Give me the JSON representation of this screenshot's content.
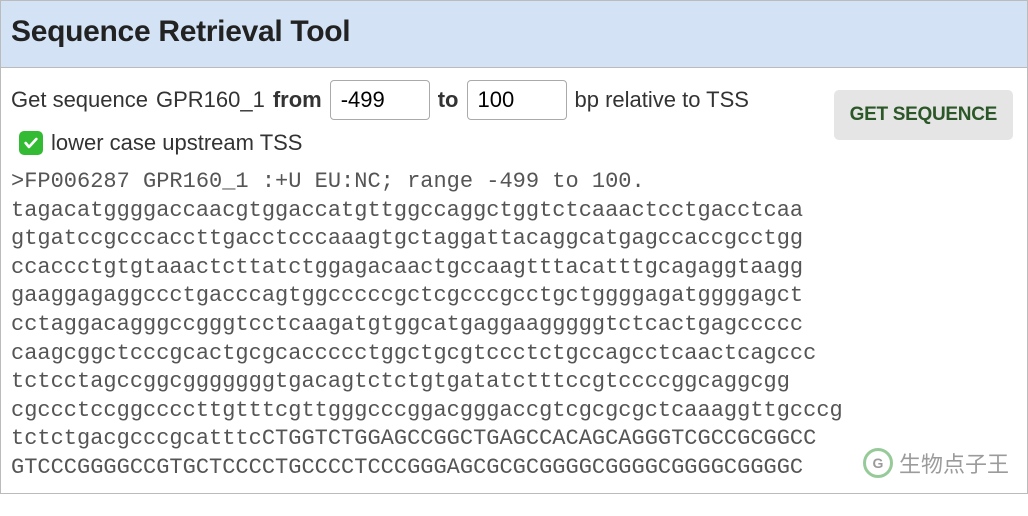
{
  "header": {
    "title": "Sequence Retrieval Tool"
  },
  "controls": {
    "seq_label_prefix": "Get sequence",
    "seq_name": "GPR160_1",
    "from_label": "from",
    "from_value": "-499",
    "to_label": "to",
    "to_value": "100",
    "suffix": "bp relative to TSS",
    "get_button_label": "GET SEQUENCE",
    "lowercase_checkbox_checked": true,
    "lowercase_label": "lower case upstream TSS"
  },
  "sequence": {
    "fasta_header": ">FP006287 GPR160_1 :+U EU:NC; range -499 to 100.",
    "lines": [
      "tagacatggggaccaacgtggaccatgttggccaggctggtctcaaactcctgacctcaa",
      "gtgatccgcccaccttgacctcccaaagtgctaggattacaggcatgagccaccgcctgg",
      "ccaccctgtgtaaactcttatctggagacaactgccaagtttacatttgcagaggtaagg",
      "gaaggagaggccctgacccagtggcccccgctcgcccgcctgctggggagatggggagct",
      "cctaggacagggccgggtcctcaagatgtggcatgaggaagggggtctcactgagccccc",
      "caagcggctcccgcactgcgcaccccctggctgcgtccctctgccagcctcaactcagccc",
      "tctcctagccggcgggggggtgacagtctctgtgatatctttccgtccccggcaggcgg",
      "cgccctccggccccttgtttcgttgggcccggacgggaccgtcgcgcgctcaaaggttgcccg",
      "tctctgacgcccgcatttcCTGGTCTGGAGCCGGCTGAGCCACAGCAGGGTCGCCGCGGCC",
      "GTCCCGGGGCCGTGCTCCCCTGCCCCTCCCGGGAGCGCGCGGGGCGGGGCGGGGCGGGGC"
    ]
  },
  "watermark": {
    "icon_text": "G",
    "label": "生物点子王"
  }
}
